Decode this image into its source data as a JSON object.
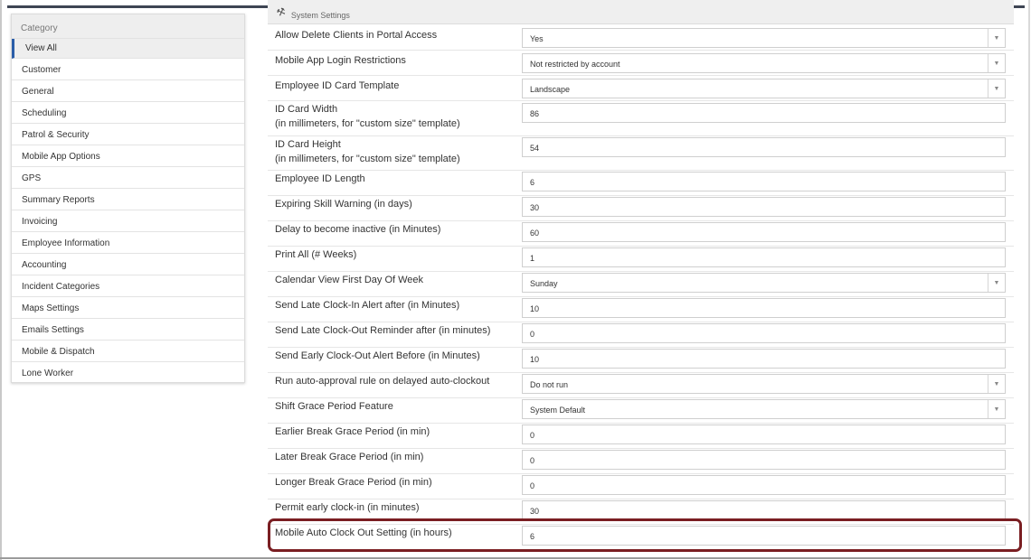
{
  "sidebar": {
    "header": "Category",
    "items": [
      {
        "label": "View All",
        "active": true
      },
      {
        "label": "Customer"
      },
      {
        "label": "General"
      },
      {
        "label": "Scheduling"
      },
      {
        "label": "Patrol & Security"
      },
      {
        "label": "Mobile App Options"
      },
      {
        "label": "GPS"
      },
      {
        "label": "Summary Reports"
      },
      {
        "label": "Invoicing"
      },
      {
        "label": "Employee Information"
      },
      {
        "label": "Accounting"
      },
      {
        "label": "Incident Categories"
      },
      {
        "label": "Maps Settings"
      },
      {
        "label": "Emails Settings"
      },
      {
        "label": "Mobile & Dispatch"
      },
      {
        "label": "Lone Worker"
      }
    ]
  },
  "panel": {
    "title": "System Settings",
    "icon": "wrench-icon"
  },
  "settings": [
    {
      "label": "Allow Delete Clients in Portal Access",
      "value": "Yes",
      "type": "select"
    },
    {
      "label": "Mobile App Login Restrictions",
      "value": "Not restricted by account",
      "type": "select"
    },
    {
      "label": "Employee ID Card Template",
      "value": "Landscape",
      "type": "select"
    },
    {
      "label": "ID Card Width",
      "sublabel": "(in millimeters, for \"custom size\" template)",
      "value": "86",
      "type": "input"
    },
    {
      "label": "ID Card Height",
      "sublabel": "(in millimeters, for \"custom size\" template)",
      "value": "54",
      "type": "input"
    },
    {
      "label": "Employee ID Length",
      "value": "6",
      "type": "input"
    },
    {
      "label": "Expiring Skill Warning (in days)",
      "value": "30",
      "type": "input"
    },
    {
      "label": "Delay to become inactive (in Minutes)",
      "value": "60",
      "type": "input"
    },
    {
      "label": "Print All (# Weeks)",
      "value": "1",
      "type": "input"
    },
    {
      "label": "Calendar View First Day Of Week",
      "value": "Sunday",
      "type": "select"
    },
    {
      "label": "Send Late Clock-In Alert after (in Minutes)",
      "value": "10",
      "type": "input"
    },
    {
      "label": "Send Late Clock-Out Reminder after (in minutes)",
      "value": "0",
      "type": "input"
    },
    {
      "label": "Send Early Clock-Out Alert Before (in Minutes)",
      "value": "10",
      "type": "input"
    },
    {
      "label": "Run auto-approval rule on delayed auto-clockout",
      "value": "Do not run",
      "type": "select"
    },
    {
      "label": "Shift Grace Period Feature",
      "value": "System Default",
      "type": "select"
    },
    {
      "label": "Earlier Break Grace Period (in min)",
      "value": "0",
      "type": "input"
    },
    {
      "label": "Later Break Grace Period (in min)",
      "value": "0",
      "type": "input"
    },
    {
      "label": "Longer Break Grace Period (in min)",
      "value": "0",
      "type": "input"
    },
    {
      "label": "Permit early clock-in (in minutes)",
      "value": "30",
      "type": "input"
    },
    {
      "label": "Mobile Auto Clock Out Setting (in hours)",
      "value": "6",
      "type": "input",
      "highlighted": true
    }
  ],
  "colors": {
    "highlight_border": "#7a1e22",
    "active_accent": "#2a5da8",
    "top_bar": "#3e4553"
  }
}
